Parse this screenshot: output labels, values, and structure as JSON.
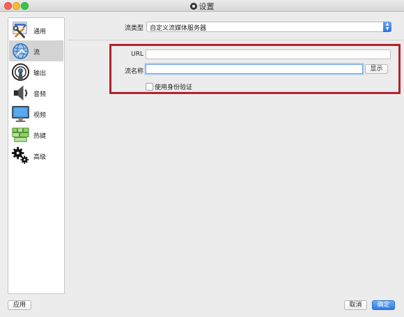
{
  "window": {
    "title": "设置"
  },
  "sidebar": {
    "items": [
      {
        "label": "通用",
        "icon": "wrench-screwdriver-icon",
        "active": false
      },
      {
        "label": "流",
        "icon": "globe-network-icon",
        "active": true
      },
      {
        "label": "输出",
        "icon": "broadcast-output-icon",
        "active": false
      },
      {
        "label": "音频",
        "icon": "speaker-icon",
        "active": false
      },
      {
        "label": "视频",
        "icon": "monitor-icon",
        "active": false
      },
      {
        "label": "热键",
        "icon": "keyboard-icon",
        "active": false
      },
      {
        "label": "高级",
        "icon": "gears-icon",
        "active": false
      }
    ]
  },
  "stream": {
    "type_label": "流类型",
    "type_value": "自定义流媒体服务器",
    "url_label": "URL",
    "url_value": "",
    "key_label": "流名称",
    "key_value": "",
    "show_button": "显示",
    "auth_label": "使用身份验证",
    "auth_checked": false
  },
  "footer": {
    "apply": "应用",
    "cancel": "取消",
    "ok": "确定"
  },
  "colors": {
    "highlight": "#b3232a",
    "accent": "#2d7be6"
  }
}
